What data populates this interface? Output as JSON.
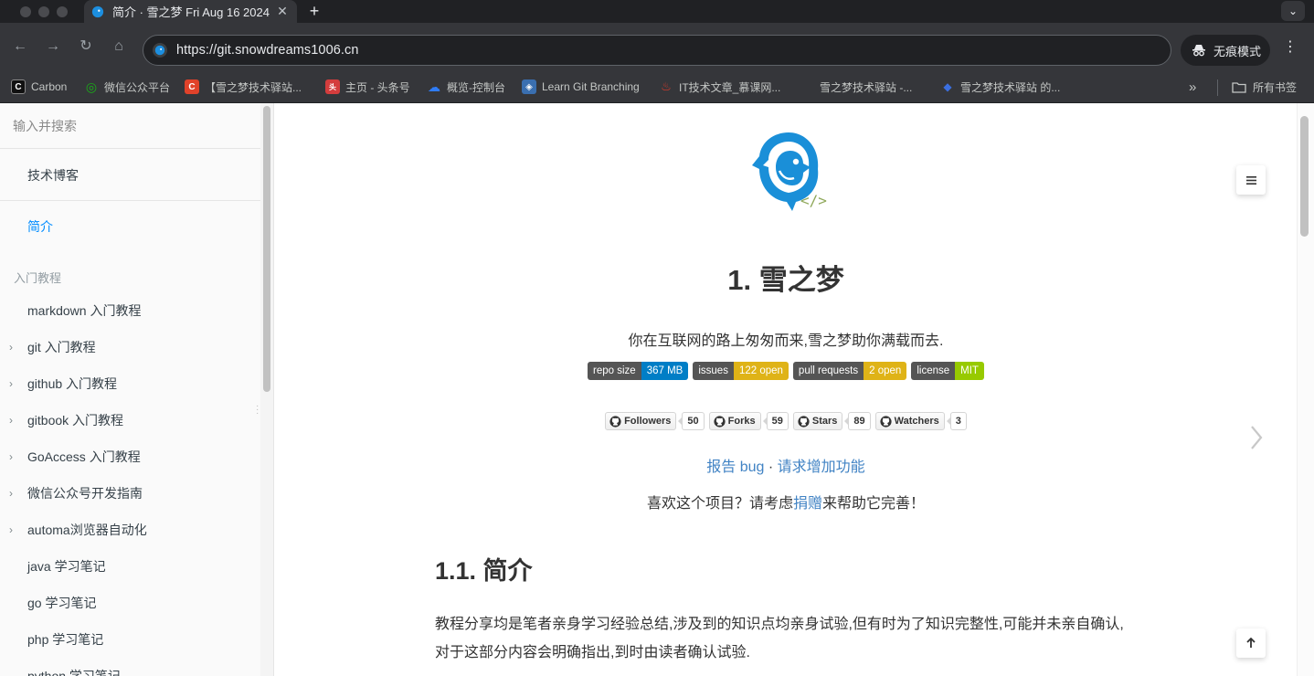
{
  "browser": {
    "tab_title": "简介 · 雪之梦 Fri Aug 16 2024",
    "url": "https://git.snowdreams1006.cn",
    "incognito_label": "无痕模式",
    "all_bookmarks": "所有书签",
    "bookmarks": [
      {
        "label": "Carbon",
        "color": "#111111",
        "glyph": "C"
      },
      {
        "label": "微信公众平台",
        "color": "#1aad19",
        "glyph": "◎"
      },
      {
        "label": "【雪之梦技术驿站...",
        "color": "#e0422a",
        "glyph": "C"
      },
      {
        "label": "主页 - 头条号",
        "color": "#d43d3d",
        "glyph": "头"
      },
      {
        "label": "概览-控制台",
        "color": "#2f7cf6",
        "glyph": "☁"
      },
      {
        "label": "Learn Git Branching",
        "color": "#3a6fb0",
        "glyph": "◈"
      },
      {
        "label": "IT技术文章_慕课网...",
        "color": "#e03b2a",
        "glyph": "♨"
      },
      {
        "label": "雪之梦技术驿站 -...",
        "color": "#35363a",
        "glyph": ""
      },
      {
        "label": "雪之梦技术驿站 的...",
        "color": "#3b6fe0",
        "glyph": "◆"
      }
    ]
  },
  "sidebar": {
    "search_placeholder": "输入并搜索",
    "blog": "技术博客",
    "intro": "简介",
    "section_header": "入门教程",
    "items": [
      {
        "label": "markdown 入门教程",
        "expandable": false
      },
      {
        "label": "git 入门教程",
        "expandable": true
      },
      {
        "label": "github 入门教程",
        "expandable": true
      },
      {
        "label": "gitbook 入门教程",
        "expandable": true
      },
      {
        "label": "GoAccess 入门教程",
        "expandable": true
      },
      {
        "label": "微信公众号开发指南",
        "expandable": true
      },
      {
        "label": "automa浏览器自动化",
        "expandable": true
      },
      {
        "label": "java 学习笔记",
        "expandable": false
      },
      {
        "label": "go 学习笔记",
        "expandable": false
      },
      {
        "label": "php 学习笔记",
        "expandable": false
      },
      {
        "label": "python 学习笔记",
        "expandable": false
      }
    ]
  },
  "main": {
    "title": "1. 雪之梦",
    "tagline": "你在互联网的路上匆匆而来,雪之梦助你满载而去.",
    "badges": [
      {
        "label": "repo size",
        "value": "367 MB",
        "color": "#007ec6"
      },
      {
        "label": "issues",
        "value": "122 open",
        "color": "#dfb317"
      },
      {
        "label": "pull requests",
        "value": "2 open",
        "color": "#dfb317"
      },
      {
        "label": "license",
        "value": "MIT",
        "color": "#97ca00"
      }
    ],
    "socials": [
      {
        "label": "Followers",
        "count": "50"
      },
      {
        "label": "Forks",
        "count": "59"
      },
      {
        "label": "Stars",
        "count": "89"
      },
      {
        "label": "Watchers",
        "count": "3"
      }
    ],
    "report_bug": "报告 bug",
    "separator": " · ",
    "feature_request": "请求增加功能",
    "donate_prefix": "喜欢这个项目？请考虑",
    "donate_link": "捐赠",
    "donate_suffix": "来帮助它完善！",
    "h2": "1.1. 简介",
    "paragraph_line1": "教程分享均是笔者亲身学习经验总结,涉及到的知识点均亲身试验,但有时为了知识完整性,可能并未亲自确认,",
    "paragraph_line2": "对于这部分内容会明确指出,到时由读者确认试验."
  }
}
